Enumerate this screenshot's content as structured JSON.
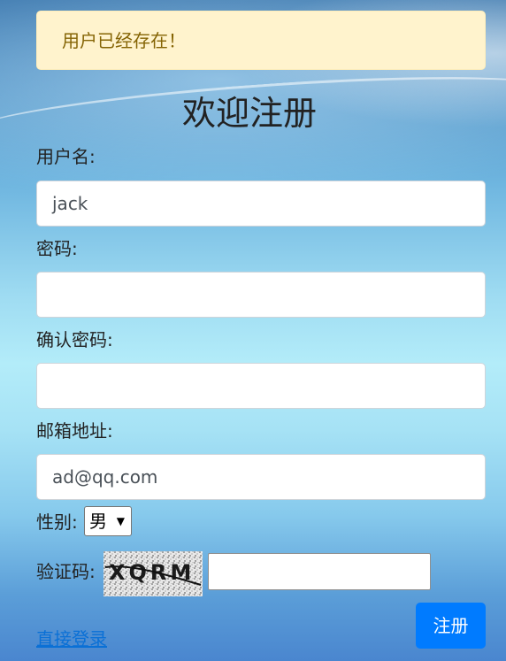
{
  "alert": {
    "message": "用户已经存在！"
  },
  "page_title": "欢迎注册",
  "form": {
    "username": {
      "label": "用户名:",
      "value": "jack"
    },
    "password": {
      "label": "密码:",
      "value": ""
    },
    "confirm_password": {
      "label": "确认密码:",
      "value": ""
    },
    "email": {
      "label": "邮箱地址:",
      "value": "ad@qq.com"
    },
    "gender": {
      "label": "性别:",
      "selected": "男"
    },
    "captcha": {
      "label": "验证码:",
      "image_text": "XQRM",
      "value": ""
    }
  },
  "submit_label": "注册",
  "login_link": "直接登录",
  "colors": {
    "alert_bg": "#fff3cd",
    "alert_text": "#856404",
    "primary": "#007bff",
    "link": "#0a70d6"
  }
}
